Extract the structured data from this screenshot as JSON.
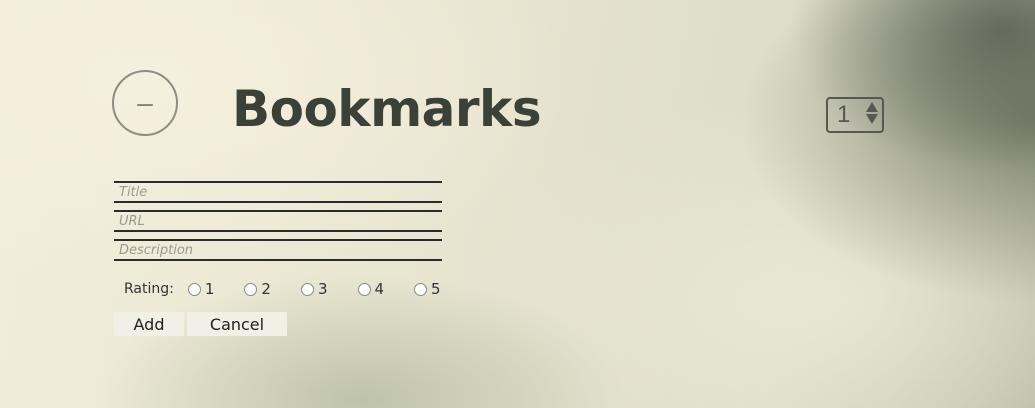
{
  "header": {
    "collapse_symbol": "–",
    "title": "Bookmarks",
    "page_value": "1"
  },
  "form": {
    "title_placeholder": "Title",
    "title_value": "",
    "url_placeholder": "URL",
    "url_value": "",
    "description_placeholder": "Description",
    "description_value": "",
    "rating_label": "Rating:",
    "rating_options": [
      "1",
      "2",
      "3",
      "4",
      "5"
    ],
    "rating_selected": null,
    "add_label": "Add",
    "cancel_label": "Cancel"
  },
  "icons": {
    "collapse": "minus-icon",
    "stepper_up": "caret-up-icon",
    "stepper_down": "caret-down-icon"
  },
  "colors": {
    "title": "#3c4138",
    "border": "#2b2b2b",
    "button_bg": "#f1efe6"
  }
}
